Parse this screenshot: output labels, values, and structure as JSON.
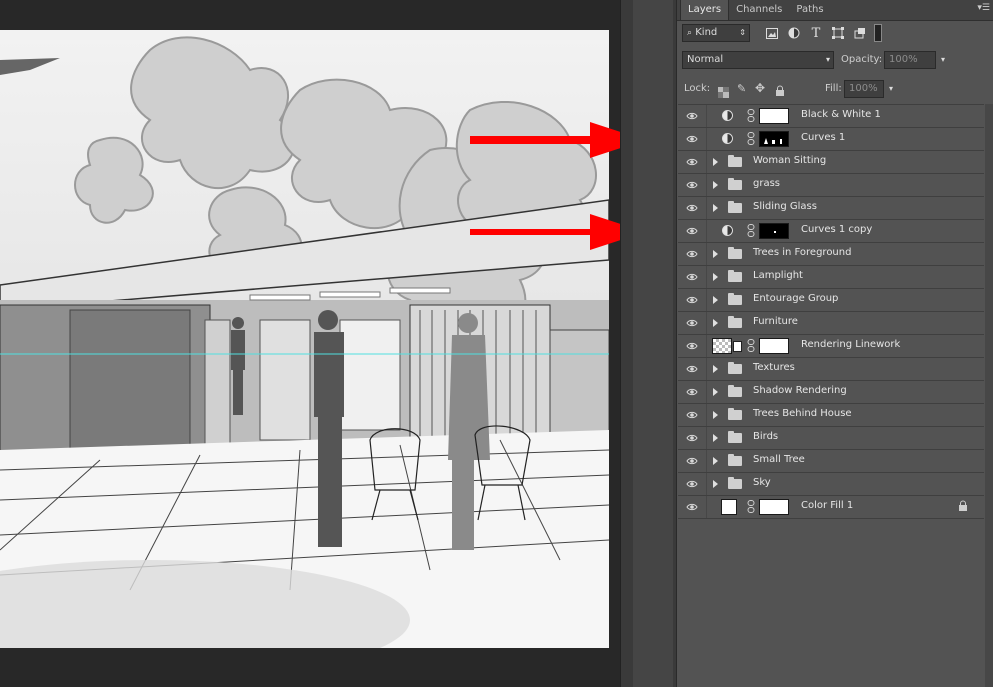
{
  "panel": {
    "tabs": [
      {
        "label": "Layers",
        "active": true
      },
      {
        "label": "Channels",
        "active": false
      },
      {
        "label": "Paths",
        "active": false
      }
    ],
    "filter": {
      "search_icon": "magnifier-icon",
      "kind": "Kind"
    },
    "blend": {
      "mode": "Normal",
      "opacity_label": "Opacity:",
      "opacity_value": "100%"
    },
    "lock": {
      "label": "Lock:",
      "fill_label": "Fill:",
      "fill_value": "100%"
    },
    "layers": [
      {
        "name": "Black & White 1",
        "type": "adjustment",
        "mask": "white"
      },
      {
        "name": "Curves 1",
        "type": "adjustment",
        "mask": "black"
      },
      {
        "name": "Woman Sitting",
        "type": "group"
      },
      {
        "name": "grass",
        "type": "group"
      },
      {
        "name": "Sliding Glass",
        "type": "group"
      },
      {
        "name": "Curves 1 copy",
        "type": "adjustment",
        "mask": "black"
      },
      {
        "name": "Trees in Foreground",
        "type": "group"
      },
      {
        "name": "Lamplight",
        "type": "group"
      },
      {
        "name": "Entourage Group",
        "type": "group"
      },
      {
        "name": "Furniture",
        "type": "group"
      },
      {
        "name": "Rendering Linework",
        "type": "pixel",
        "mask": "white"
      },
      {
        "name": "Textures",
        "type": "group"
      },
      {
        "name": "Shadow Rendering",
        "type": "group"
      },
      {
        "name": "Trees Behind House",
        "type": "group"
      },
      {
        "name": "Birds",
        "type": "group"
      },
      {
        "name": "Small Tree",
        "type": "group"
      },
      {
        "name": "Sky",
        "type": "group"
      },
      {
        "name": "Color Fill 1",
        "type": "fill",
        "mask": "white",
        "locked": true
      }
    ]
  },
  "annotations": {
    "arrow_color": "#ff0000"
  },
  "guide_color": "#4fe0e0"
}
